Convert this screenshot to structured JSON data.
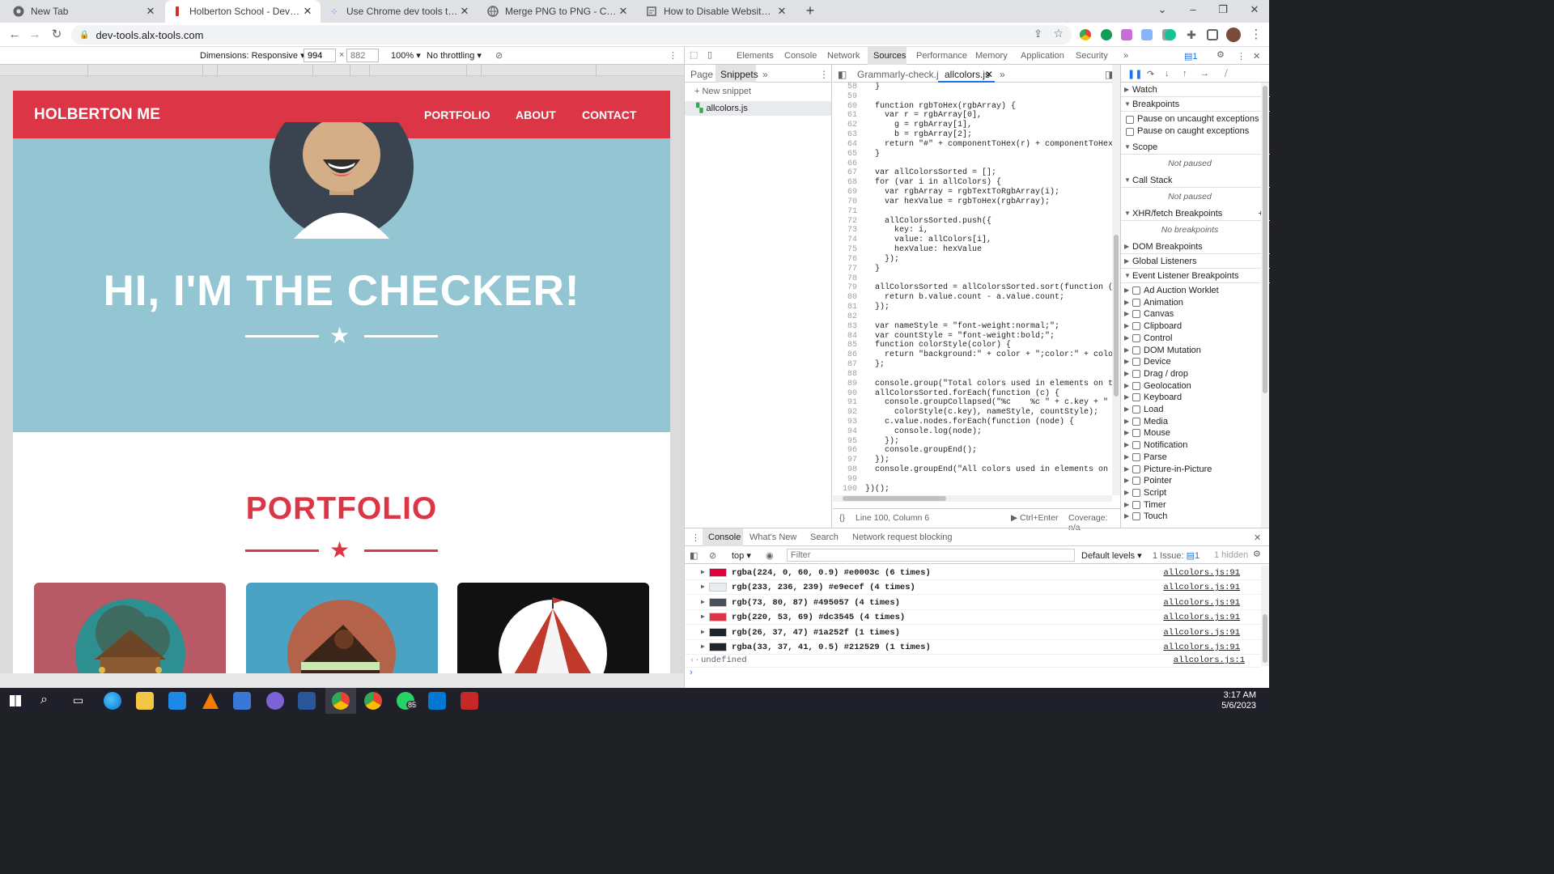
{
  "browser": {
    "tabs": [
      {
        "title": "New Tab",
        "icon": "chrome-icon"
      },
      {
        "title": "Holberton School - Developer to",
        "icon": "holberton-icon",
        "active": true
      },
      {
        "title": "Use Chrome dev tools to force el",
        "icon": "dots-icon"
      },
      {
        "title": "Merge PNG to PNG - Convert yo",
        "icon": "globe-icon"
      },
      {
        "title": "How to Disable Website CSS Styl",
        "icon": "page-icon"
      }
    ],
    "url": "dev-tools.alx-tools.com"
  },
  "device_toolbar": {
    "dimensions_label": "Dimensions: Responsive",
    "width": "994",
    "height_placeholder": "882",
    "zoom": "100%",
    "throttling": "No throttling"
  },
  "page": {
    "brand": "HOLBERTON ME",
    "nav": [
      "PORTFOLIO",
      "ABOUT",
      "CONTACT"
    ],
    "hero_title": "HI, I'M THE CHECKER!",
    "section_title": "PORTFOLIO",
    "colors": {
      "red": "#dc3545",
      "hero": "#93c6d2",
      "white": "#ffffff"
    }
  },
  "devtools": {
    "tabs": [
      "Elements",
      "Console",
      "Network",
      "Sources",
      "Performance",
      "Memory",
      "Application",
      "Security"
    ],
    "active_tab": "Sources",
    "issues_count": "1",
    "nav_tabs": [
      "Page",
      "Snippets"
    ],
    "new_snippet": "New snippet",
    "snippet_file": "allcolors.js",
    "editor_tabs": [
      "Grammarly-check.js",
      "allcolors.js"
    ],
    "code_lines": [
      {
        "n": 58,
        "t": "  }"
      },
      {
        "n": 59,
        "t": ""
      },
      {
        "n": 60,
        "t": "  function rgbToHex(rgbArray) {"
      },
      {
        "n": 61,
        "t": "    var r = rgbArray[0],"
      },
      {
        "n": 62,
        "t": "      g = rgbArray[1],"
      },
      {
        "n": 63,
        "t": "      b = rgbArray[2];"
      },
      {
        "n": 64,
        "t": "    return \"#\" + componentToHex(r) + componentToHex(g) +"
      },
      {
        "n": 65,
        "t": "  }"
      },
      {
        "n": 66,
        "t": ""
      },
      {
        "n": 67,
        "t": "  var allColorsSorted = [];"
      },
      {
        "n": 68,
        "t": "  for (var i in allColors) {"
      },
      {
        "n": 69,
        "t": "    var rgbArray = rgbTextToRgbArray(i);"
      },
      {
        "n": 70,
        "t": "    var hexValue = rgbToHex(rgbArray);"
      },
      {
        "n": 71,
        "t": ""
      },
      {
        "n": 72,
        "t": "    allColorsSorted.push({"
      },
      {
        "n": 73,
        "t": "      key: i,"
      },
      {
        "n": 74,
        "t": "      value: allColors[i],"
      },
      {
        "n": 75,
        "t": "      hexValue: hexValue"
      },
      {
        "n": 76,
        "t": "    });"
      },
      {
        "n": 77,
        "t": "  }"
      },
      {
        "n": 78,
        "t": ""
      },
      {
        "n": 79,
        "t": "  allColorsSorted = allColorsSorted.sort(function (a, b)"
      },
      {
        "n": 80,
        "t": "    return b.value.count - a.value.count;"
      },
      {
        "n": 81,
        "t": "  });"
      },
      {
        "n": 82,
        "t": ""
      },
      {
        "n": 83,
        "t": "  var nameStyle = \"font-weight:normal;\";"
      },
      {
        "n": 84,
        "t": "  var countStyle = \"font-weight:bold;\";"
      },
      {
        "n": 85,
        "t": "  function colorStyle(color) {"
      },
      {
        "n": 86,
        "t": "    return \"background:\" + color + \";color:\" + color + \""
      },
      {
        "n": 87,
        "t": "  };"
      },
      {
        "n": 88,
        "t": ""
      },
      {
        "n": 89,
        "t": "  console.group(\"Total colors used in elements on the pa"
      },
      {
        "n": 90,
        "t": "  allColorsSorted.forEach(function (c) {"
      },
      {
        "n": 91,
        "t": "    console.groupCollapsed(\"%c    %c \" + c.key + \" \" + c"
      },
      {
        "n": 92,
        "t": "      colorStyle(c.key), nameStyle, countStyle);"
      },
      {
        "n": 93,
        "t": "    c.value.nodes.forEach(function (node) {"
      },
      {
        "n": 94,
        "t": "      console.log(node);"
      },
      {
        "n": 95,
        "t": "    });"
      },
      {
        "n": 96,
        "t": "    console.groupEnd();"
      },
      {
        "n": 97,
        "t": "  });"
      },
      {
        "n": 98,
        "t": "  console.groupEnd(\"All colors used in elements on the p"
      },
      {
        "n": 99,
        "t": ""
      },
      {
        "n": 100,
        "t": "})();"
      }
    ],
    "status": {
      "position": "Line 100, Column 6",
      "run": "Ctrl+Enter",
      "coverage": "Coverage: n/a"
    },
    "right_pane": {
      "watch": "Watch",
      "breakpoints": "Breakpoints",
      "pause_uncaught": "Pause on uncaught exceptions",
      "pause_caught": "Pause on caught exceptions",
      "scope": "Scope",
      "not_paused": "Not paused",
      "call_stack": "Call Stack",
      "xhr": "XHR/fetch Breakpoints",
      "no_breakpoints": "No breakpoints",
      "dom_bp": "DOM Breakpoints",
      "global": "Global Listeners",
      "event_bp": "Event Listener Breakpoints",
      "events": [
        "Ad Auction Worklet",
        "Animation",
        "Canvas",
        "Clipboard",
        "Control",
        "DOM Mutation",
        "Device",
        "Drag / drop",
        "Geolocation",
        "Keyboard",
        "Load",
        "Media",
        "Mouse",
        "Notification",
        "Parse",
        "Picture-in-Picture",
        "Pointer",
        "Script",
        "Timer",
        "Touch"
      ]
    },
    "console": {
      "tabs": [
        "Console",
        "What's New",
        "Search",
        "Network request blocking"
      ],
      "context": "top",
      "filter_placeholder": "Filter",
      "levels": "Default levels",
      "issues": "1 Issue:",
      "issues_count": "1",
      "hidden": "1 hidden",
      "rows": [
        {
          "color": "#e0003c",
          "text": "rgba(224, 0, 60, 0.9) #e0003c (6 times)",
          "src": "allcolors.js:91"
        },
        {
          "color": "#e9ecef",
          "text": "rgb(233, 236, 239) #e9ecef (4 times)",
          "src": "allcolors.js:91"
        },
        {
          "color": "#495057",
          "text": "rgb(73, 80, 87) #495057 (4 times)",
          "src": "allcolors.js:91"
        },
        {
          "color": "#dc3545",
          "text": "rgb(220, 53, 69) #dc3545 (4 times)",
          "src": "allcolors.js:91"
        },
        {
          "color": "#1a252f",
          "text": "rgb(26, 37, 47) #1a252f (1 times)",
          "src": "allcolors.js:91"
        },
        {
          "color": "#212529",
          "text": "rgba(33, 37, 41, 0.5) #212529 (1 times)",
          "src": "allcolors.js:91"
        }
      ],
      "result": "undefined",
      "result_src": "allcolors.js:1"
    }
  },
  "taskbar": {
    "time": "3:17 AM",
    "date": "5/6/2023",
    "whatsapp_badge": "85"
  }
}
